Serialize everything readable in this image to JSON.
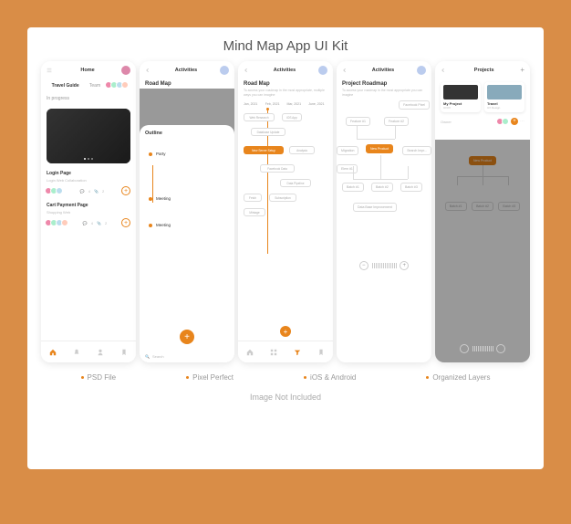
{
  "title": "Mind Map App UI Kit",
  "features": [
    "PSD File",
    "Pixel Perfect",
    "iOS & Android",
    "Organized Layers"
  ],
  "disclaimer": "Image Not Included",
  "screen1": {
    "header": "Home",
    "tabs": [
      "Travel Guide",
      "Team"
    ],
    "section": "In progress",
    "item1_title": "Login Page",
    "item1_sub": "Login Web Collaboration",
    "item1_meta1": "4",
    "item1_meta2": "2",
    "item2_title": "Cart Payment Page",
    "item2_sub": "Shopping Web",
    "item2_meta1": "4",
    "item2_meta2": "2"
  },
  "screen2": {
    "header": "Activities",
    "title": "Road Map",
    "panel": "Outline",
    "items": [
      "Party",
      "Meeting",
      "Meeting"
    ],
    "search": "Search"
  },
  "screen3": {
    "header": "Activities",
    "title": "Road Map",
    "sub": "To access your roadmap in the most appropriate, multiple ways you can imagine",
    "months": [
      "Jan, 2021",
      "Feb, 2021",
      "Mar, 2021",
      "June, 2021"
    ],
    "bars": {
      "web": "Web Research",
      "ios": "iOS App",
      "db": "Database Update",
      "server": "New Server Setup",
      "analysis": "Analysis",
      "fb": "Facebook Data",
      "dp": "Data Pipeline",
      "fetch": "Fetch",
      "subs": "Subscription",
      "mint": "Mintage"
    }
  },
  "screen4": {
    "header": "Activities",
    "title": "Project Roadmap",
    "sub": "To access your roadmap in the most appropriate you can imagine",
    "nodes": {
      "fb_pixel": "Facebook Pixel",
      "f1": "Feature #1",
      "f2": "Feature #2",
      "mig": "Migration",
      "product": "New Product",
      "search": "Search Impr...",
      "elem": "Elem #1",
      "b1": "Batch #1",
      "b2": "Batch #2",
      "b3": "Batch #3",
      "db": "Data Base Improvement"
    }
  },
  "screen5": {
    "header": "Projects",
    "card1": "My Project",
    "card1_sub": "UI/UX",
    "card2": "Travel",
    "card2_sub": "UX Design",
    "owner": "Owner",
    "product": "New Product",
    "b1": "Batch #1",
    "b2": "Batch #2",
    "b3": "Batch #3"
  }
}
